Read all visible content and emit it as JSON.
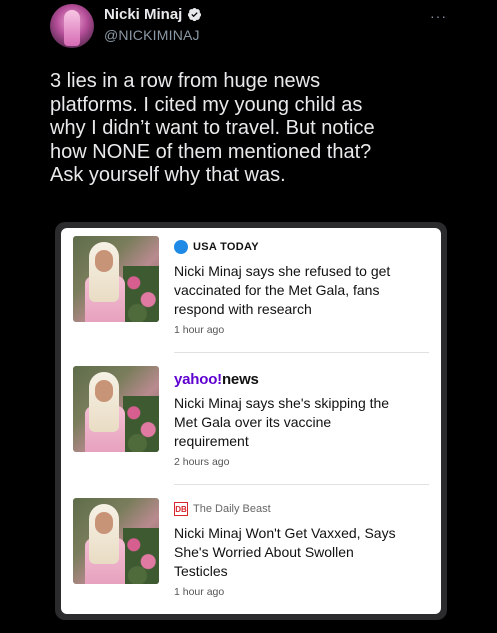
{
  "tweet": {
    "display_name": "Nicki Minaj",
    "handle": "@NICKIMINAJ",
    "more_glyph": "···",
    "text_lines": [
      "3 lies in a row from huge news",
      "platforms. I cited my young child as",
      "why I didn’t want to travel. But notice",
      "how NONE of them mentioned that?",
      "Ask yourself why that was."
    ]
  },
  "colors": {
    "background": "#000000",
    "verified": "#1d9bf0",
    "usa_today_dot": "#1e8ae6",
    "yahoo_purple": "#5f01d1",
    "daily_beast_red": "#d8262e"
  },
  "articles": [
    {
      "source": "USA TODAY",
      "headline_lines": [
        "Nicki Minaj says she refused to get",
        "vaccinated for the Met Gala, fans",
        "respond with research"
      ],
      "time": "1 hour ago"
    },
    {
      "source_brand": "yahoo!",
      "source_suffix": "news",
      "headline_lines": [
        "Nicki Minaj says she's skipping the",
        "Met Gala over its vaccine",
        "requirement"
      ],
      "time": "2 hours ago"
    },
    {
      "source_logo": "DB",
      "source": "The Daily Beast",
      "headline_lines": [
        "Nicki Minaj Won't Get Vaxxed, Says",
        "She's Worried About Swollen",
        "Testicles"
      ],
      "time": "1 hour ago"
    }
  ]
}
